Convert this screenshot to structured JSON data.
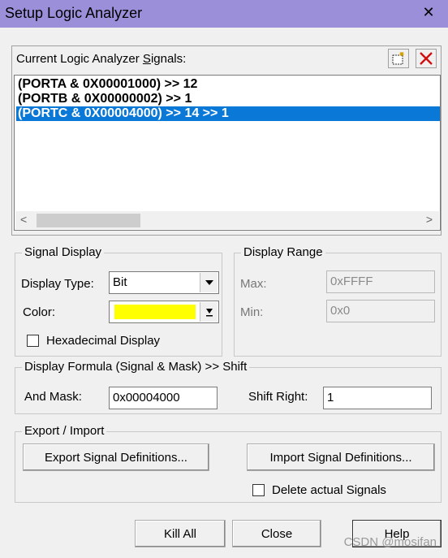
{
  "window": {
    "title": "Setup Logic Analyzer",
    "close_glyph": "✕"
  },
  "signals": {
    "label_prefix": "Current Logic Analyzer ",
    "label_underlined": "S",
    "label_suffix": "ignals:",
    "new_icon": "new-item-icon",
    "delete_icon": "delete-x-icon",
    "items": [
      {
        "text": "(PORTA & 0X00001000) >> 12",
        "selected": false
      },
      {
        "text": "(PORTB & 0X00000002) >> 1",
        "selected": false
      },
      {
        "text": "(PORTC & 0X00004000) >> 14 >> 1",
        "selected": true
      }
    ],
    "scroll_left": "<",
    "scroll_right": ">"
  },
  "signal_display": {
    "title": "Signal Display",
    "display_type_label": "Display Type:",
    "display_type_value": "Bit",
    "color_label": "Color:",
    "color_value": "#ffff00",
    "hex_label": "Hexadecimal Display",
    "hex_checked": false
  },
  "display_range": {
    "title": "Display Range",
    "max_label": "Max:",
    "max_value": "0xFFFF",
    "min_label": "Min:",
    "min_value": "0x0"
  },
  "formula": {
    "title": "Display Formula (Signal & Mask) >> Shift",
    "and_mask_label": "And Mask:",
    "and_mask_value": "0x00004000",
    "shift_right_label": "Shift Right:",
    "shift_right_value": "1"
  },
  "export_import": {
    "title": "Export / Import",
    "export_label": "Export Signal Definitions...",
    "import_label": "Import Signal Definitions...",
    "delete_label": "Delete actual Signals",
    "delete_checked": false
  },
  "buttons": {
    "kill_all": "Kill All",
    "close": "Close",
    "help": "Help"
  },
  "watermark": "CSDN @mosifan"
}
